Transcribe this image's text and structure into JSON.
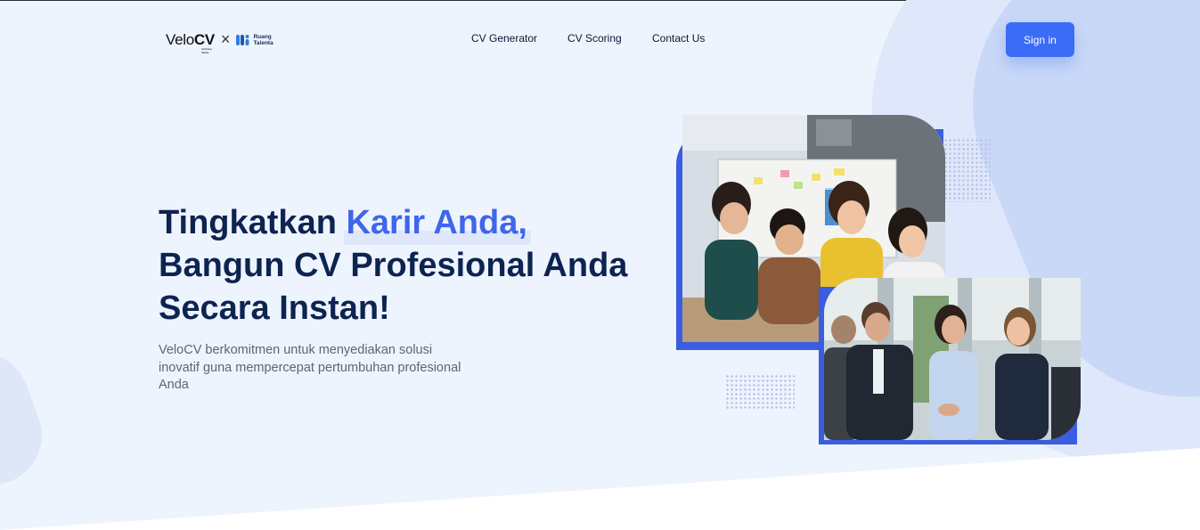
{
  "brand": {
    "logo_light": "Velo",
    "logo_bold": "CV",
    "tagline": "by Ruang Talenta",
    "separator": "×",
    "partner_line1": "Ruang",
    "partner_line2": "Talenta"
  },
  "nav": {
    "links": [
      "CV Generator",
      "CV Scoring",
      "Contact Us"
    ],
    "signin_label": "Sign in"
  },
  "hero": {
    "title_part1": "Tingkatkan ",
    "title_highlight": "Karir Anda",
    "title_comma": ",",
    "title_line2": "Bangun CV Profesional Anda",
    "title_line3": "Secara Instan!",
    "description": "VeloCV berkomitmen untuk menyediakan solusi inovatif guna mempercepat pertumbuhan profesional Anda"
  },
  "colors": {
    "accent": "#3b6cf6",
    "title": "#0d2451",
    "highlight_text": "#3f66ea",
    "background": "#eef4fd"
  }
}
